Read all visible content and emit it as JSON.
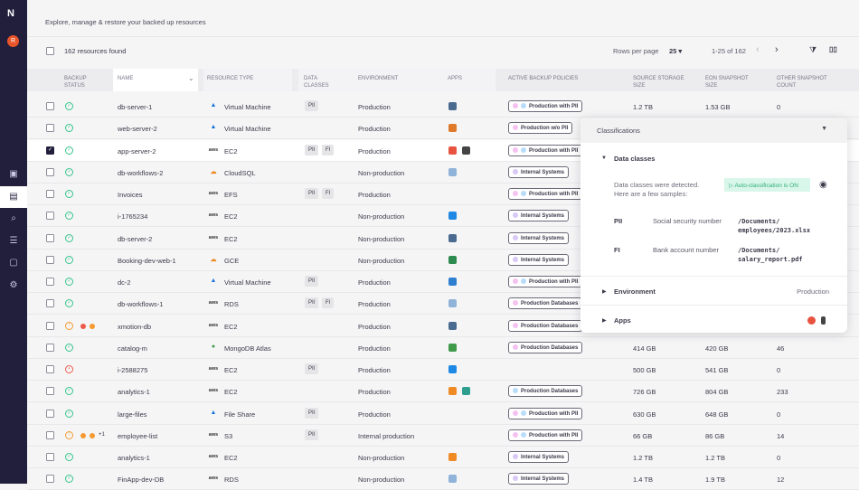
{
  "sidebar": {
    "logo": "N",
    "avatar": "R",
    "items": [
      {
        "icon": "layout-icon",
        "glyph": "▣"
      },
      {
        "icon": "archive-icon",
        "glyph": "▤",
        "active": true
      },
      {
        "icon": "search-icon",
        "glyph": "⌕"
      },
      {
        "icon": "checklist-icon",
        "glyph": "☰"
      },
      {
        "icon": "clipboard-icon",
        "glyph": "▢"
      },
      {
        "icon": "gear-icon",
        "glyph": "⚙"
      }
    ]
  },
  "header": {
    "subtitle": "Explore, manage & restore your backed up resources"
  },
  "toolbar": {
    "found": "162 resources found",
    "rows_per_page_label": "Rows per page",
    "rows_per_page": "25 ▾",
    "range": "1-25 of 162",
    "prev": "‹",
    "next": "›",
    "filter": "⧩",
    "columns": "▯▯"
  },
  "columns": {
    "backup_status": "Backup status",
    "name": "Name",
    "resource_type": "Resource type",
    "data_classes": "Data classes",
    "environment": "Environment",
    "apps": "Apps",
    "policies": "Active backup policies",
    "source_size": "Source storage size",
    "eon_size": "Eon snapshot size",
    "other_count": "Other snapshot count"
  },
  "colors": {
    "sidebar": "#221f3d",
    "ok": "#35c48a",
    "warning": "#f59a30",
    "error": "#ee5a4a",
    "pink": "#f4c2f0",
    "blue": "#b9dcfa",
    "purple": "#d8c8f6"
  },
  "rows": [
    {
      "status": "ok",
      "name": "db-server-1",
      "rt_icon": "azure-icon",
      "type": "Virtual Machine",
      "classes": [
        "PII"
      ],
      "env": "Production",
      "apps": [
        "#4b6a8f"
      ],
      "policy": "Production with PII",
      "pdots": [
        "#f4c2f0",
        "#b9dcfa"
      ],
      "src": "1.2 TB",
      "eon": "1.53 GB",
      "other": "0"
    },
    {
      "status": "ok",
      "name": "web-server-2",
      "rt_icon": "azure-icon",
      "type": "Virtual Machine",
      "classes": [],
      "env": "Production",
      "apps": [
        "#e0792a"
      ],
      "policy": "Production w/o PII",
      "pdots": [
        "#f4c2f0"
      ]
    },
    {
      "status": "ok",
      "name": "app-server-2",
      "rt_icon": "aws-icon",
      "type": "EC2",
      "classes": [
        "PII",
        "FI"
      ],
      "env": "Production",
      "apps": [
        "#e8533f",
        "#444"
      ],
      "policy": "Production with PII",
      "pdots": [
        "#f4c2f0",
        "#b9dcfa"
      ],
      "selected": true
    },
    {
      "status": "ok",
      "name": "db-workflows-2",
      "rt_icon": "gcp-icon",
      "type": "CloudSQL",
      "classes": [],
      "env": "Non-production",
      "apps": [
        "#8fb3d9"
      ],
      "policy": "Internal Systems",
      "pdots": [
        "#d8c8f6"
      ]
    },
    {
      "status": "ok",
      "name": "Invoices",
      "rt_icon": "aws-icon",
      "type": "EFS",
      "classes": [
        "PII",
        "FI"
      ],
      "env": "Production",
      "apps": [],
      "policy": "Production with PII",
      "pdots": [
        "#f4c2f0",
        "#b9dcfa"
      ]
    },
    {
      "status": "ok",
      "name": "i-1765234",
      "rt_icon": "aws-icon",
      "type": "EC2",
      "classes": [],
      "env": "Non-production",
      "apps": [
        "#1e88e5"
      ],
      "policy": "Internal Systems",
      "pdots": [
        "#d8c8f6"
      ]
    },
    {
      "status": "ok",
      "name": "db-server-2",
      "rt_icon": "aws-icon",
      "type": "EC2",
      "classes": [],
      "env": "Non-production",
      "apps": [
        "#4b6a8f"
      ],
      "policy": "Internal Systems",
      "pdots": [
        "#d8c8f6"
      ]
    },
    {
      "status": "ok",
      "name": "Booking-dev-web-1",
      "rt_icon": "gcp-icon",
      "type": "GCE",
      "classes": [],
      "env": "Non-production",
      "apps": [
        "#2e8b4f"
      ],
      "policy": "Internal Systems",
      "pdots": [
        "#d8c8f6"
      ]
    },
    {
      "status": "ok",
      "name": "dc-2",
      "rt_icon": "azure-icon",
      "type": "Virtual Machine",
      "classes": [
        "PII"
      ],
      "env": "Production",
      "apps": [
        "#2f80d1"
      ],
      "policy": "Production with PII",
      "pdots": [
        "#f4c2f0",
        "#b9dcfa"
      ]
    },
    {
      "status": "ok",
      "name": "db-workflows-1",
      "rt_icon": "aws-icon",
      "type": "RDS",
      "classes": [
        "PII",
        "FI"
      ],
      "env": "Production",
      "apps": [
        "#8fb3d9"
      ],
      "policy": "Production Databases",
      "pdots": [
        "#f4c2f0"
      ]
    },
    {
      "status": "warning",
      "dots": [
        "#ee5a4a",
        "#f59a30"
      ],
      "name": "xmotion-db",
      "rt_icon": "aws-icon",
      "type": "EC2",
      "classes": [],
      "env": "Production",
      "apps": [
        "#4b6a8f"
      ],
      "policy": "Production Databases",
      "pdots": [
        "#f4c2f0"
      ]
    },
    {
      "status": "ok",
      "name": "catalog-m",
      "rt_icon": "mongodb-icon",
      "type": "MongoDB Atlas",
      "classes": [],
      "env": "Production",
      "apps": [
        "#3f9a4a"
      ],
      "policy": "Production Databases",
      "pdots": [
        "#f4c2f0"
      ],
      "src": "414 GB",
      "eon": "420 GB",
      "other": "46"
    },
    {
      "status": "error",
      "name": "i-2588275",
      "rt_icon": "aws-icon",
      "type": "EC2",
      "classes": [
        "PII"
      ],
      "env": "Production",
      "apps": [
        "#1e88e5"
      ],
      "policy": "",
      "pdots": [],
      "src": "500 GB",
      "eon": "541 GB",
      "other": "0"
    },
    {
      "status": "ok",
      "name": "analytics-1",
      "rt_icon": "aws-icon",
      "type": "EC2",
      "classes": [],
      "env": "Production",
      "apps": [
        "#f08a24",
        "#2e9e8f"
      ],
      "policy": "Production Databases",
      "pdots": [
        "#b9dcfa"
      ],
      "src": "726 GB",
      "eon": "804 GB",
      "other": "233"
    },
    {
      "status": "ok",
      "name": "large-files",
      "rt_icon": "azure-icon",
      "type": "File Share",
      "classes": [
        "PII"
      ],
      "env": "Production",
      "apps": [],
      "policy": "Production with PII",
      "pdots": [
        "#f4c2f0",
        "#b9dcfa"
      ],
      "src": "630 GB",
      "eon": "648 GB",
      "other": "0"
    },
    {
      "status": "warning",
      "dots": [
        "#f59a30",
        "#f59a30"
      ],
      "more": "+1",
      "name": "employee-list",
      "rt_icon": "aws-icon",
      "type": "S3",
      "classes": [
        "PII"
      ],
      "env": "Internal production",
      "apps": [],
      "policy": "Production with PII",
      "pdots": [
        "#f4c2f0",
        "#b9dcfa"
      ],
      "src": "66 GB",
      "eon": "86 GB",
      "other": "14"
    },
    {
      "status": "ok",
      "name": "analytics-1",
      "rt_icon": "aws-icon",
      "type": "EC2",
      "classes": [],
      "env": "Non-production",
      "apps": [
        "#f08a24"
      ],
      "policy": "Internal Systems",
      "pdots": [
        "#d8c8f6"
      ],
      "src": "1.2 TB",
      "eon": "1.2 TB",
      "other": "0"
    },
    {
      "status": "ok",
      "name": "FinApp-dev-DB",
      "rt_icon": "aws-icon",
      "type": "RDS",
      "classes": [],
      "env": "Non-production",
      "apps": [
        "#8fb3d9"
      ],
      "policy": "Internal Systems",
      "pdots": [
        "#d8c8f6"
      ],
      "src": "1.4 TB",
      "eon": "1.9 TB",
      "other": "12"
    }
  ],
  "panel": {
    "title": "Classifications",
    "data_classes": "Data classes",
    "description": "Data classes were detected. Here are a few samples:",
    "auto": "Auto-classification is ON",
    "samples": [
      {
        "cls": "PII",
        "type": "Social security number",
        "path": "/Documents/ employees/2023.xlsx"
      },
      {
        "cls": "FI",
        "type": "Bank account number",
        "path": "/Documents/ salary_report.pdf"
      }
    ],
    "environment_label": "Environment",
    "environment_value": "Production",
    "apps_label": "Apps"
  }
}
